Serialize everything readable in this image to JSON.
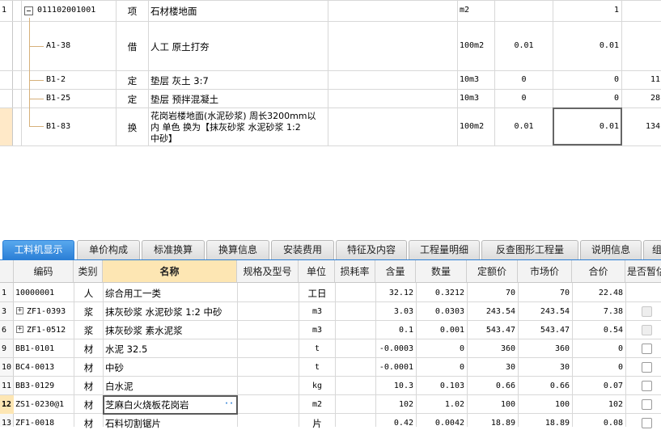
{
  "top_rows": [
    {
      "index": "1",
      "code": "011102001001",
      "type": "项",
      "name": "石材楼地面",
      "unit": "m2",
      "col1": "",
      "col2": "1",
      "col3": ""
    },
    {
      "index": "",
      "code": "A1-38",
      "type": "借",
      "name": "人工 原土打夯",
      "unit": "100m2",
      "col1": "0.01",
      "col2": "0.01",
      "col3": ""
    },
    {
      "index": "",
      "code": "B1-2",
      "type": "定",
      "name": "垫层 灰土 3:7",
      "unit": "10m3",
      "col1": "0",
      "col2": "0",
      "col3": "11"
    },
    {
      "index": "",
      "code": "B1-25",
      "type": "定",
      "name": "垫层 预拌混凝土",
      "unit": "10m3",
      "col1": "0",
      "col2": "0",
      "col3": "28"
    },
    {
      "index": "",
      "code": "B1-83",
      "type": "换",
      "name_lines": [
        "花岗岩楼地面(水泥砂浆) 周长3200mm以",
        "内 单色  换为【抹灰砂浆 水泥砂浆 1:2",
        "中砂】"
      ],
      "unit": "100m2",
      "col1": "0.01",
      "col2": "0.01",
      "col3": "134"
    }
  ],
  "tabs": [
    "工料机显示",
    "单价构成",
    "标准换算",
    "换算信息",
    "安装费用",
    "特征及内容",
    "工程量明细",
    "反查图形工程量",
    "说明信息",
    "组"
  ],
  "columns": [
    "编码",
    "类别",
    "名称",
    "规格及型号",
    "单位",
    "损耗率",
    "含量",
    "数量",
    "定额价",
    "市场价",
    "合价",
    "是否暂估"
  ],
  "bottom_rows": [
    {
      "index": "1",
      "code": "10000001",
      "expand": false,
      "cat": "人",
      "name": "综合用工一类",
      "spec": "",
      "unit": "工日",
      "loss": "",
      "content": "32.12",
      "qty": "0.3212",
      "price": "70",
      "market": "70",
      "total": "22.48",
      "check": "none"
    },
    {
      "index": "3",
      "code": "ZF1-0393",
      "expand": true,
      "cat": "浆",
      "name": "抹灰砂浆 水泥砂浆 1:2 中砂",
      "spec": "",
      "unit": "m3",
      "loss": "",
      "content": "3.03",
      "qty": "0.0303",
      "price": "243.54",
      "market": "243.54",
      "total": "7.38",
      "check": "disabled"
    },
    {
      "index": "6",
      "code": "ZF1-0512",
      "expand": true,
      "cat": "浆",
      "name": "抹灰砂浆 素水泥浆",
      "spec": "",
      "unit": "m3",
      "loss": "",
      "content": "0.1",
      "qty": "0.001",
      "price": "543.47",
      "market": "543.47",
      "total": "0.54",
      "check": "disabled"
    },
    {
      "index": "9",
      "code": "BB1-0101",
      "expand": false,
      "cat": "材",
      "name": "水泥 32.5",
      "spec": "",
      "unit": "t",
      "loss": "",
      "content": "-0.0003",
      "qty": "0",
      "price": "360",
      "market": "360",
      "total": "0",
      "check": "box"
    },
    {
      "index": "10",
      "code": "BC4-0013",
      "expand": false,
      "cat": "材",
      "name": "中砂",
      "spec": "",
      "unit": "t",
      "loss": "",
      "content": "-0.0001",
      "qty": "0",
      "price": "30",
      "market": "30",
      "total": "0",
      "check": "box"
    },
    {
      "index": "11",
      "code": "BB3-0129",
      "expand": false,
      "cat": "材",
      "name": "白水泥",
      "spec": "",
      "unit": "kg",
      "loss": "",
      "content": "10.3",
      "qty": "0.103",
      "price": "0.66",
      "market": "0.66",
      "total": "0.07",
      "check": "box"
    },
    {
      "index": "12",
      "code": "ZS1-0230@1",
      "expand": false,
      "cat": "材",
      "name": "芝麻白火烧板花岗岩",
      "spec": "",
      "unit": "m2",
      "loss": "",
      "content": "102",
      "qty": "1.02",
      "price": "100",
      "market": "100",
      "total": "102",
      "check": "box",
      "active": true
    },
    {
      "index": "13",
      "code": "ZF1-0018",
      "expand": false,
      "cat": "材",
      "name": "石料切割锯片",
      "spec": "",
      "unit": "片",
      "loss": "",
      "content": "0.42",
      "qty": "0.0042",
      "price": "18.89",
      "market": "18.89",
      "total": "0.08",
      "check": "box"
    }
  ],
  "ellipsis_label": "···",
  "colors": {
    "tab_active": "#2b7fd6",
    "header_selected": "#fde6b3",
    "tree_line": "#d6b07a",
    "selection": "#ffe9c8"
  }
}
